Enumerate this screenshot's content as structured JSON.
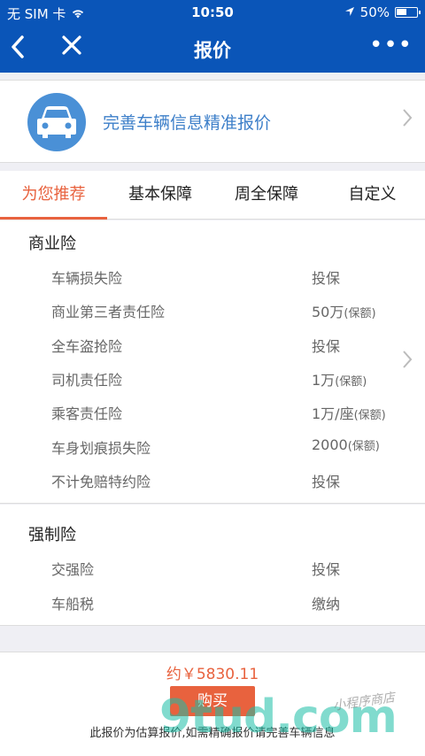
{
  "status_bar": {
    "carrier": "无 SIM 卡",
    "time": "10:50",
    "battery": "50%"
  },
  "nav": {
    "title": "报价",
    "back_icon": "chevron-left-icon",
    "close_icon": "close-icon",
    "more": "•••"
  },
  "car_banner": {
    "text": "完善车辆信息精准报价"
  },
  "tabs": [
    "为您推荐",
    "基本保障",
    "周全保障",
    "自定义"
  ],
  "active_tab": 0,
  "commercial": {
    "title": "商业险",
    "rows": [
      {
        "label": "车辆损失险",
        "value": "投保",
        "unit": ""
      },
      {
        "label": "商业第三者责任险",
        "value": "50万",
        "unit": "(保额)"
      },
      {
        "label": "全车盗抢险",
        "value": "投保",
        "unit": ""
      },
      {
        "label": "司机责任险",
        "value": "1万",
        "unit": "(保额)"
      },
      {
        "label": "乘客责任险",
        "value": "1万/座",
        "unit": "(保额)"
      },
      {
        "label": "车身划痕损失险",
        "value": "2000",
        "unit": "(保额)"
      },
      {
        "label": "不计免赔特约险",
        "value": "投保",
        "unit": ""
      }
    ]
  },
  "compulsory": {
    "title": "强制险",
    "rows": [
      {
        "label": "交强险",
        "value": "投保"
      },
      {
        "label": "车船税",
        "value": "缴纳"
      }
    ]
  },
  "footer": {
    "price": "约￥5830.11",
    "buy_label": "购买",
    "note": "此报价为估算报价,如需精确报价请完善车辆信息"
  },
  "watermark": {
    "main": "9tud.com",
    "sub": "小程序商店"
  },
  "colors": {
    "brand_blue": "#0a55b8",
    "accent": "#e8623e",
    "link_blue": "#3d7fc9"
  }
}
